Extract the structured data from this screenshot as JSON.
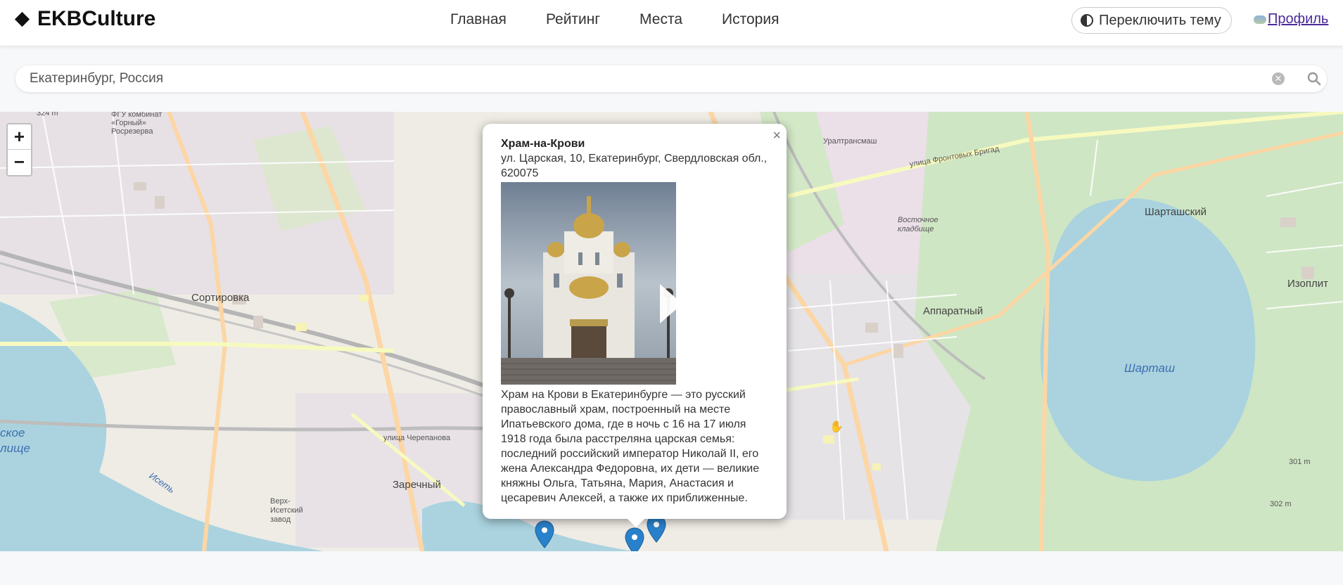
{
  "header": {
    "logo_text": "EKBCulture",
    "nav": [
      "Главная",
      "Рейтинг",
      "Места",
      "История"
    ],
    "theme_button": "Переключить тему",
    "profile_link": "Профиль"
  },
  "search": {
    "value": "Екатеринбург, Россия",
    "placeholder": "Екатеринбург, Россия"
  },
  "map": {
    "zoom_in": "+",
    "zoom_out": "−",
    "labels": {
      "sortirovka": "Сортировка",
      "zarechny": "Заречный",
      "apparatny": "Аппаратный",
      "shartashsky": "Шарташский",
      "izoplit": "Изоплит",
      "shartash_lake": "Шарташ",
      "vostochnoe": "Восточное кладбище",
      "fgu": "ФГУ комбинат «Горный» Росрезерва",
      "verkh_isetsky": "Верх-Исетский завод",
      "ural_transmash": "Уралтрансмаш",
      "frontovykh_brigad": "улица Фронтовых Бригад",
      "cherepanova": "улица Черепанова",
      "peak1": "301 m",
      "peak2": "302 m",
      "alt1": "324 m",
      "pond_left": "ское лище",
      "iset": "Исеть"
    }
  },
  "popup": {
    "title": "Храм-на-Крови",
    "address": "ул. Царская, 10, Екатеринбург, Свердловская обл., 620075",
    "description": "Храм на Крови в Екатеринбурге — это русский православный храм, построенный на месте Ипатьевского дома, где в ночь с 16 на 17 июля 1918 года была расстреляна царская семья: последний российский император Николай II, его жена Александра Федоровна, их дети — великие княжны Ольга, Татьяна, Мария, Анастасия и цесаревич Алексей, а также их приближенные.",
    "close": "×"
  },
  "colors": {
    "marker": "#2a81cb",
    "profile_link": "#4b2a99",
    "water": "#aad3df"
  }
}
